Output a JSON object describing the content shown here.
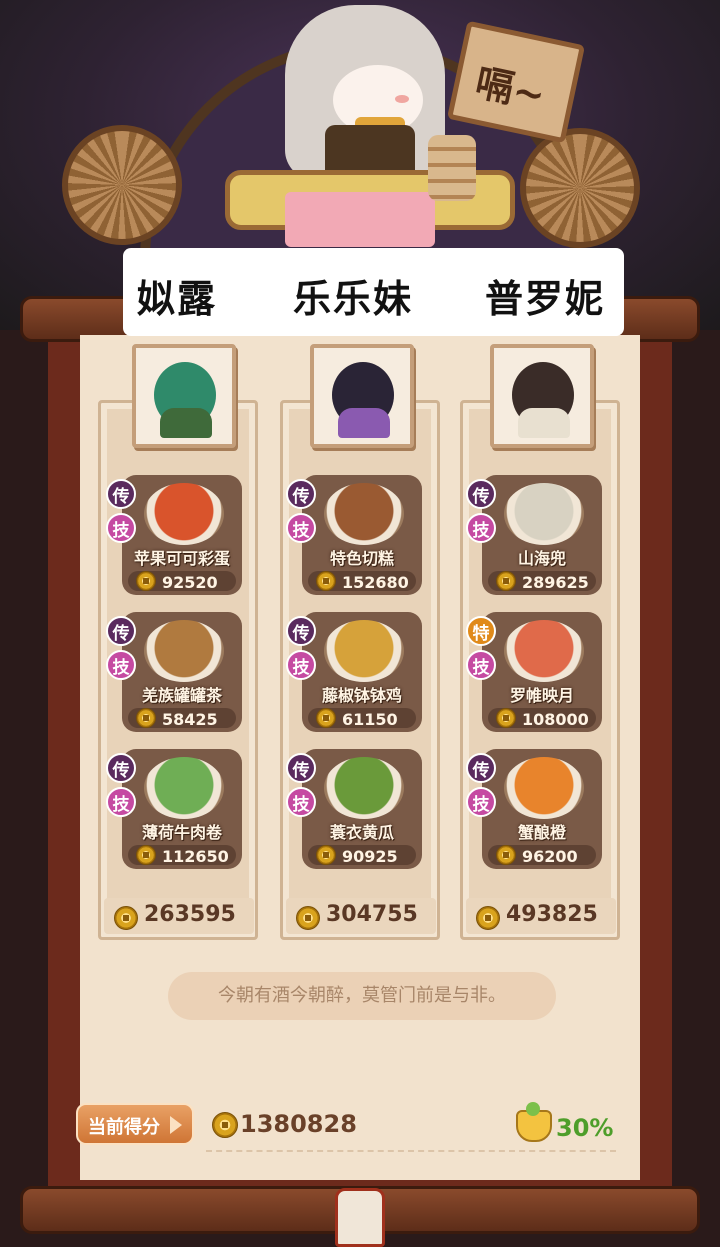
{
  "scene": {
    "sign_text": "嗝~"
  },
  "chefs": [
    {
      "name": "姒露",
      "total": "263595",
      "dishes": [
        {
          "badge_top": "传",
          "badge_top_type": "legend",
          "badge_skill": "技",
          "name": "苹果可可彩蛋",
          "score": "92520",
          "color": "#d9542c"
        },
        {
          "badge_top": "传",
          "badge_top_type": "legend",
          "badge_skill": "技",
          "name": "羌族罐罐茶",
          "score": "58425",
          "color": "#b07a3f"
        },
        {
          "badge_top": "传",
          "badge_top_type": "legend",
          "badge_skill": "技",
          "name": "薄荷牛肉卷",
          "score": "112650",
          "color": "#6fae55"
        }
      ]
    },
    {
      "name": "乐乐妹",
      "total": "304755",
      "dishes": [
        {
          "badge_top": "传",
          "badge_top_type": "legend",
          "badge_skill": "技",
          "name": "特色切糕",
          "score": "152680",
          "color": "#9a5a32"
        },
        {
          "badge_top": "传",
          "badge_top_type": "legend",
          "badge_skill": "技",
          "name": "藤椒钵钵鸡",
          "score": "61150",
          "color": "#d6a23a"
        },
        {
          "badge_top": "传",
          "badge_top_type": "legend",
          "badge_skill": "技",
          "name": "蓑衣黄瓜",
          "score": "90925",
          "color": "#6a9a3a"
        }
      ]
    },
    {
      "name": "普罗妮",
      "total": "493825",
      "dishes": [
        {
          "badge_top": "传",
          "badge_top_type": "legend",
          "badge_skill": "技",
          "name": "山海兜",
          "score": "289625",
          "color": "#d8d2c2"
        },
        {
          "badge_top": "特",
          "badge_top_type": "special",
          "badge_skill": "技",
          "name": "罗帷映月",
          "score": "108000",
          "color": "#e06a4a"
        },
        {
          "badge_top": "传",
          "badge_top_type": "legend",
          "badge_skill": "技",
          "name": "蟹酿橙",
          "score": "96200",
          "color": "#e8842c"
        }
      ]
    }
  ],
  "quote": "今朝有酒今朝醉，莫管门前是与非。",
  "footer": {
    "score_label": "当前得分",
    "current_score": "1380828",
    "bonus": "30%"
  },
  "colors": {
    "board": "#6c2a1c",
    "paper": "#f2e2cd",
    "card": "#7a5a47",
    "legend_badge": "#5a2a5e",
    "special_badge": "#e08a1a",
    "skill_badge": "#c54aa2",
    "bonus_green": "#4e9e2a"
  }
}
